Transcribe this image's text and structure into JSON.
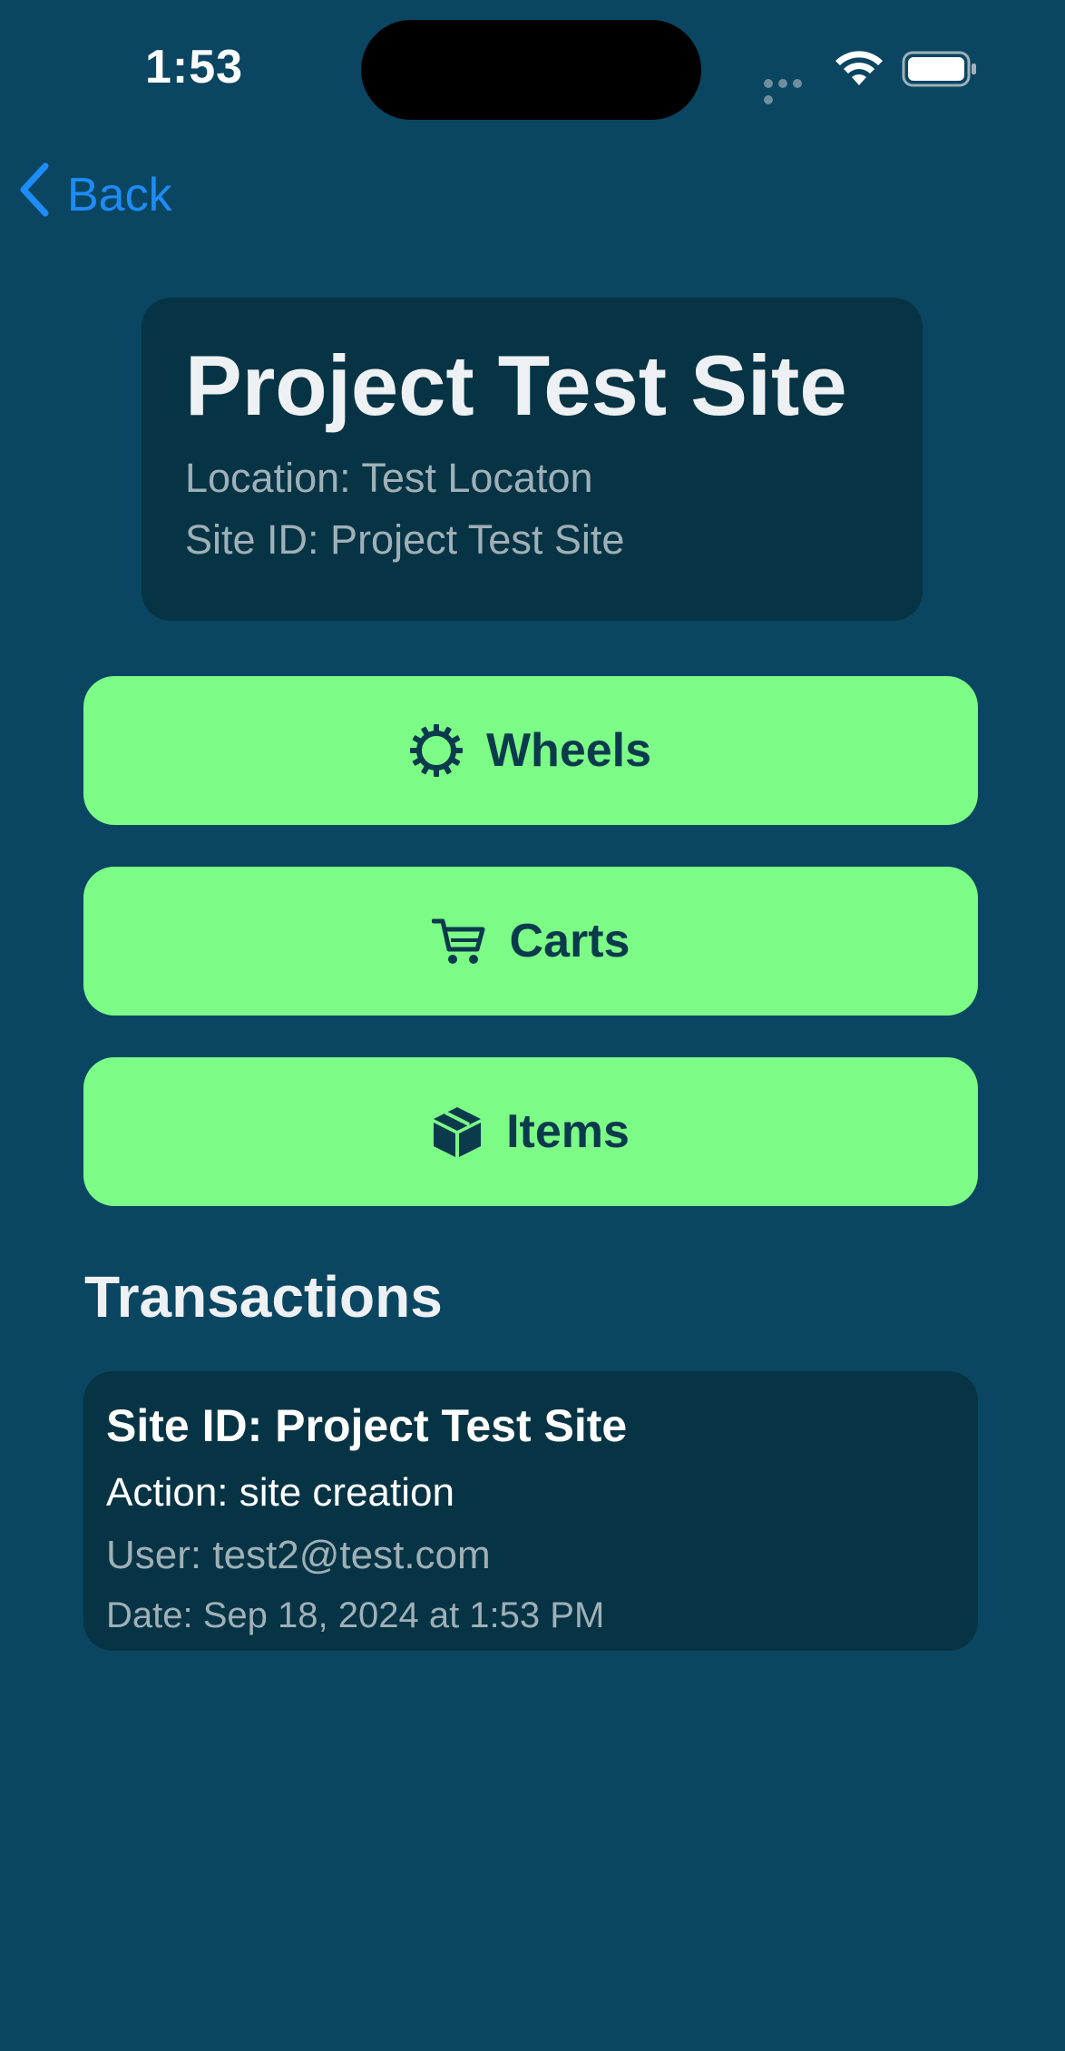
{
  "status_bar": {
    "time": "1:53",
    "signal_icon": "signal-dots-icon",
    "wifi_icon": "wifi-icon",
    "battery_icon": "battery-icon"
  },
  "nav": {
    "back_label": "Back",
    "back_icon": "chevron-left-icon",
    "accent_color": "#1d8cf8"
  },
  "site": {
    "title": "Project Test Site",
    "location": "Location: Test Locaton",
    "site_id": "Site ID: Project Test Site"
  },
  "actions": [
    {
      "label": "Wheels",
      "icon": "gear-icon"
    },
    {
      "label": "Carts",
      "icon": "cart-icon"
    },
    {
      "label": "Items",
      "icon": "box-icon"
    }
  ],
  "button_color": "#7cfc86",
  "transactions": {
    "title": "Transactions",
    "items": [
      {
        "site_id": "Site ID: Project Test Site",
        "action": "Action: site creation",
        "user": "User: test2@test.com",
        "date": "Date: Sep 18, 2024 at 1:53 PM"
      }
    ]
  }
}
